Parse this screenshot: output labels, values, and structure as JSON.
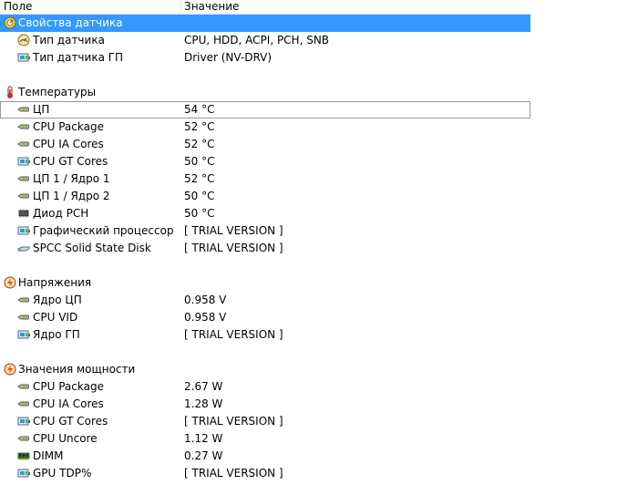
{
  "columns": {
    "field": "Поле",
    "value": "Значение"
  },
  "sensor_props": {
    "title": "Свойства датчика",
    "type_label": "Тип датчика",
    "type_value": "CPU, HDD, ACPI, PCH, SNB",
    "gpu_type_label": "Тип датчика ГП",
    "gpu_type_value": "Driver  (NV-DRV)"
  },
  "temps": {
    "title": "Температуры",
    "items": [
      {
        "label": "ЦП",
        "value": "54 °C"
      },
      {
        "label": "CPU Package",
        "value": "52 °C"
      },
      {
        "label": "CPU IA Cores",
        "value": "52 °C"
      },
      {
        "label": "CPU GT Cores",
        "value": "50 °C"
      },
      {
        "label": "ЦП 1 / Ядро 1",
        "value": "52 °C"
      },
      {
        "label": "ЦП 1 / Ядро 2",
        "value": "50 °C"
      },
      {
        "label": "Диод PCH",
        "value": "50 °C"
      },
      {
        "label": "Графический процессор",
        "value": "[ TRIAL VERSION ]"
      },
      {
        "label": "SPCC Solid State Disk",
        "value": "[ TRIAL VERSION ]"
      }
    ]
  },
  "voltages": {
    "title": "Напряжения",
    "items": [
      {
        "label": "Ядро ЦП",
        "value": "0.958 V"
      },
      {
        "label": "CPU VID",
        "value": "0.958 V"
      },
      {
        "label": "Ядро ГП",
        "value": "[ TRIAL VERSION ]"
      }
    ]
  },
  "power": {
    "title": "Значения мощности",
    "items": [
      {
        "label": "CPU Package",
        "value": "2.67 W"
      },
      {
        "label": "CPU IA Cores",
        "value": "1.28 W"
      },
      {
        "label": "CPU GT Cores",
        "value": "[ TRIAL VERSION ]"
      },
      {
        "label": "CPU Uncore",
        "value": "1.12 W"
      },
      {
        "label": "DIMM",
        "value": "0.27 W"
      },
      {
        "label": "GPU TDP%",
        "value": "[ TRIAL VERSION ]"
      }
    ]
  },
  "icons": {
    "sensor_props": "sensor-properties-icon",
    "sensor_type": "gauge-icon",
    "gpu_type": "gpu-card-icon",
    "temps": "thermometer-icon",
    "probe": "temperature-probe-icon",
    "gpu": "gpu-card-icon",
    "disk": "disk-icon",
    "chip": "chip-icon",
    "voltage": "voltage-icon",
    "power": "power-icon",
    "dimm": "memory-module-icon"
  },
  "colors": {
    "selection": "#3399ff",
    "header_separator": "#e5e5e5"
  }
}
